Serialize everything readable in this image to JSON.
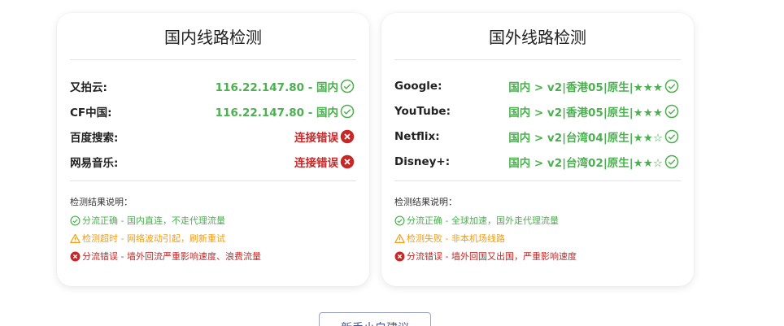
{
  "domestic": {
    "title": "国内线路检测",
    "rows": [
      {
        "label": "又拍云:",
        "value": "116.22.147.80 - 国内",
        "status": "ok"
      },
      {
        "label": "CF中国:",
        "value": "116.22.147.80 - 国内",
        "status": "ok"
      },
      {
        "label": "百度搜索:",
        "value": "连接错误",
        "status": "error"
      },
      {
        "label": "网易音乐:",
        "value": "连接错误",
        "status": "error"
      }
    ],
    "legend": {
      "title": "检测结果说明：",
      "items": [
        {
          "text": "分流正确 - 国内直连，不走代理流量",
          "type": "ok"
        },
        {
          "text": "检测超时 - 网络波动引起，刷新重试",
          "type": "warn"
        },
        {
          "text": "分流错误 - 墙外回流严重影响速度、浪费流量",
          "type": "error"
        }
      ]
    }
  },
  "foreign": {
    "title": "国外线路检测",
    "rows": [
      {
        "label": "Google:",
        "value": "国内 > v2|香港05|原生|★★★",
        "status": "ok"
      },
      {
        "label": "YouTube:",
        "value": "国内 > v2|香港05|原生|★★★",
        "status": "ok"
      },
      {
        "label": "Netflix:",
        "value": "国内 > v2|台湾04|原生|★★☆",
        "status": "ok"
      },
      {
        "label": "Disney+:",
        "value": "国内 > v2|台湾02|原生|★★☆",
        "status": "ok"
      }
    ],
    "legend": {
      "title": "检测结果说明：",
      "items": [
        {
          "text": "分流正确 - 全球加速，国外走代理流量",
          "type": "ok"
        },
        {
          "text": "检测失败 - 非本机场线路",
          "type": "warn"
        },
        {
          "text": "分流错误 - 墙外回国又出国，严重影响速度",
          "type": "error"
        }
      ]
    }
  },
  "bottom_button": {
    "label": "新手小白建议"
  },
  "colors": {
    "ok": "#4caf50",
    "warn": "#f39c12",
    "error": "#c62828"
  },
  "icons": {
    "ok": "check-circle-icon",
    "warn": "warning-triangle-icon",
    "error": "x-circle-icon"
  }
}
